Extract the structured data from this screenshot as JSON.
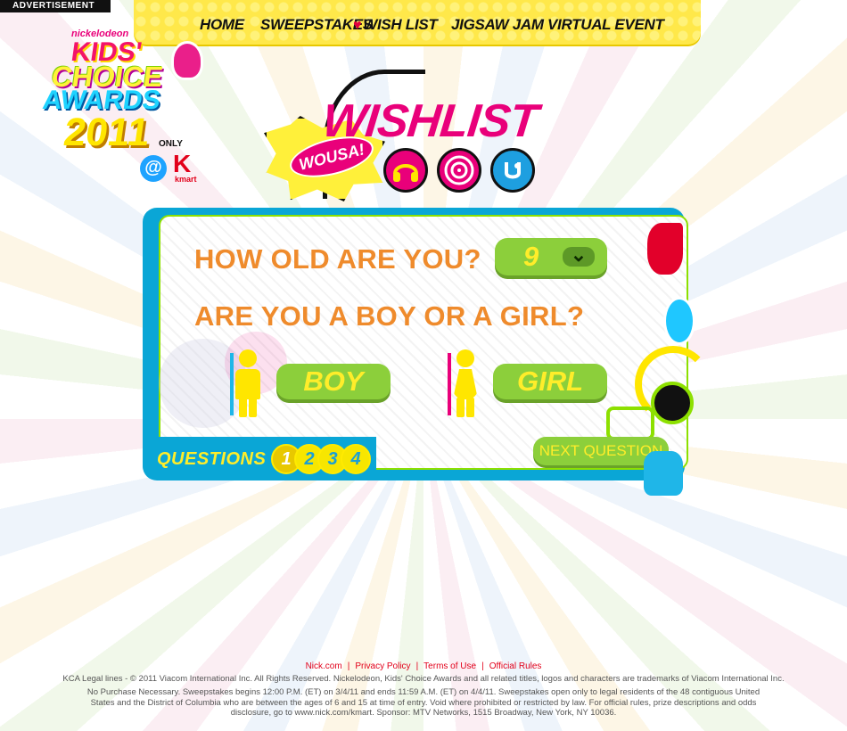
{
  "ad_label": "ADVERTISEMENT",
  "nav": {
    "items": [
      "HOME",
      "SWEEPSTAKES",
      "WISH LIST",
      "JIGSAW JAM",
      "VIRTUAL EVENT"
    ]
  },
  "logo": {
    "brand": "nickelodeon",
    "line1": "KIDS'",
    "line2": "CHOICE",
    "line3": "AWARDS",
    "year": "2011",
    "only_label": "ONLY",
    "at_symbol": "@",
    "store_letter": "K",
    "store_name": "kmart"
  },
  "header": {
    "burst_text": "WOUSA!",
    "title": "WISHLIST",
    "icons": [
      "headphones-icon",
      "record-icon",
      "mascot-icon"
    ]
  },
  "quiz": {
    "question_age": "HOW OLD ARE YOU?",
    "age_value": "9",
    "question_gender": "ARE YOU A BOY OR A GIRL?",
    "boy_label": "BOY",
    "girl_label": "GIRL",
    "questions_label": "QUESTIONS",
    "question_numbers": [
      "1",
      "2",
      "3",
      "4"
    ],
    "next_label": "NEXT QUESTION"
  },
  "colors": {
    "orange_text": "#ef8b2c",
    "green_button": "#8ccf3b",
    "yellow_text": "#ffed2a",
    "card_blue": "#0aa6d6",
    "pink": "#e9007a"
  },
  "footer": {
    "links": [
      "Nick.com",
      "Privacy Policy",
      "Terms of Use",
      "Official Rules"
    ],
    "legal": "KCA Legal lines - © 2011 Viacom International Inc. All Rights Reserved. Nickelodeon, Kids' Choice Awards and all related titles, logos and characters are trademarks of Viacom International Inc.",
    "fine_print": "No Purchase Necessary. Sweepstakes begins 12:00 P.M. (ET) on 3/4/11 and ends 11:59 A.M. (ET) on 4/4/11. Sweepstakes open only to legal residents of the 48 contiguous United States and the District of Columbia who are between the ages of 6 and 15 at time of entry. Void where prohibited or restricted by law. For official rules, prize descriptions and odds disclosure, go to www.nick.com/kmart. Sponsor: MTV Networks, 1515 Broadway, New York, NY 10036."
  }
}
